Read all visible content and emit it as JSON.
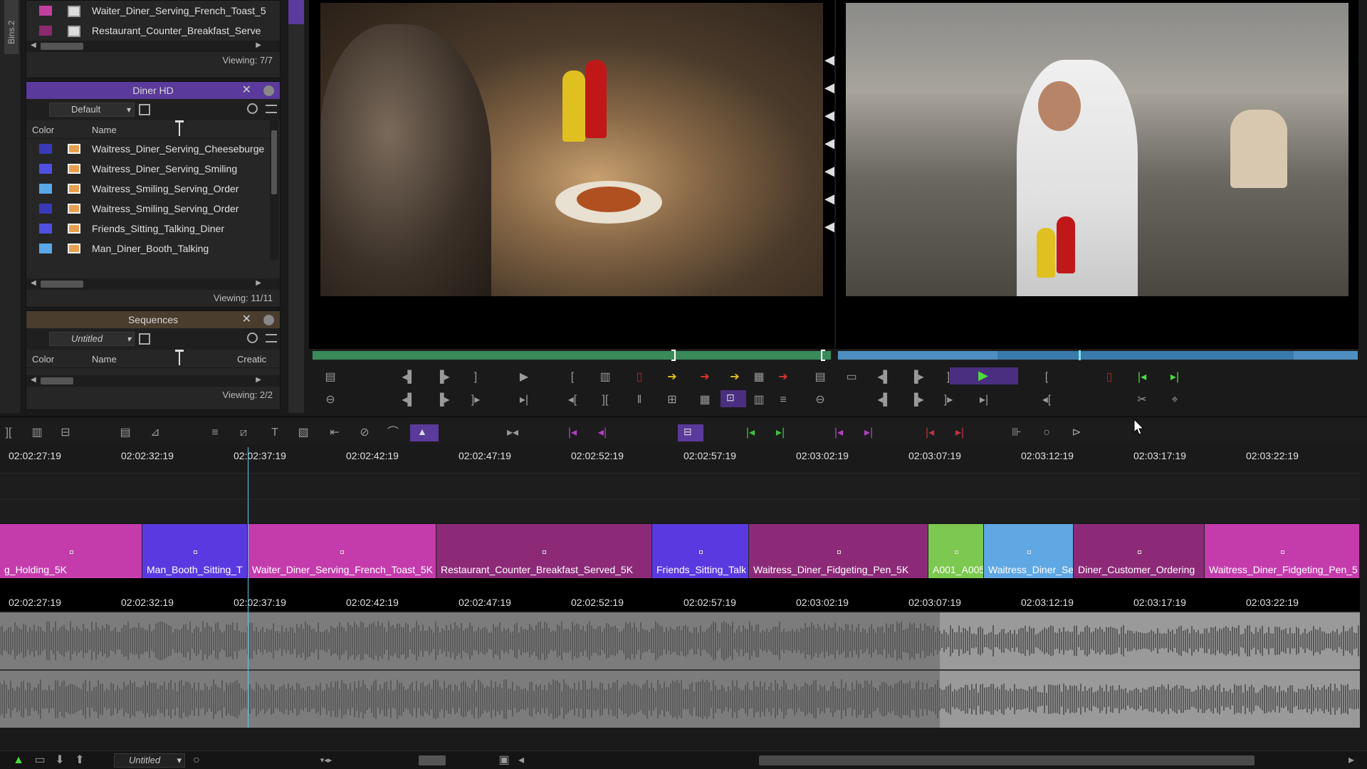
{
  "bins_tab_label": "Bins.2",
  "top_bin": {
    "items": [
      {
        "name": "Waiter_Diner_Serving_French_Toast_5",
        "color": "#c040a0"
      },
      {
        "name": "Restaurant_Counter_Breakfast_Serve",
        "color": "#8c2a70"
      }
    ],
    "viewing": "Viewing: 7/7"
  },
  "diner_bin": {
    "title": "Diner HD",
    "view": "Default",
    "col_color": "Color",
    "col_name": "Name",
    "items": [
      {
        "name": "Waitress_Diner_Serving_Cheeseburge",
        "color": "#3a3ab8"
      },
      {
        "name": "Waitress_Diner_Serving_Smiling",
        "color": "#5050e0"
      },
      {
        "name": "Waitress_Smiling_Serving_Order",
        "color": "#5aa8e8"
      },
      {
        "name": "Waitress_Smiling_Serving_Order",
        "color": "#3a3ab8"
      },
      {
        "name": "Friends_Sitting_Talking_Diner",
        "color": "#5050e0"
      },
      {
        "name": "Man_Diner_Booth_Talking",
        "color": "#5aa8e8"
      }
    ],
    "viewing": "Viewing: 11/11"
  },
  "sequences_bin": {
    "title": "Sequences",
    "view": "Untitled",
    "col_color": "Color",
    "col_name": "Name",
    "col_creation": "Creatic",
    "viewing": "Viewing: 2/2"
  },
  "ruler_timecodes": [
    "02:02:27:19",
    "02:02:32:19",
    "02:02:37:19",
    "02:02:42:19",
    "02:02:47:19",
    "02:02:52:19",
    "02:02:57:19",
    "02:03:02:19",
    "02:03:07:19",
    "02:03:12:19",
    "02:03:17:19",
    "02:03:22:19"
  ],
  "clips": [
    {
      "name": "g_Holding_5K",
      "color": "#c43cac"
    },
    {
      "name": "Man_Booth_Sitting_T",
      "color": "#5a3ae0"
    },
    {
      "name": "Waiter_Diner_Serving_French_Toast_5K",
      "color": "#c43cac"
    },
    {
      "name": "Restaurant_Counter_Breakfast_Served_5K",
      "color": "#8c2a78"
    },
    {
      "name": "Friends_Sitting_Talk",
      "color": "#5a3ae0"
    },
    {
      "name": "Waitress_Diner_Fidgeting_Pen_5K",
      "color": "#8c2a78"
    },
    {
      "name": "A001_A005",
      "color": "#7cc850"
    },
    {
      "name": "Waitress_Diner_Se",
      "color": "#60a8e4"
    },
    {
      "name": "Diner_Customer_Ordering",
      "color": "#8c2a78"
    },
    {
      "name": "Waitress_Diner_Fidgeting_Pen_5",
      "color": "#c43cac"
    }
  ],
  "status_bar": {
    "sequence_name": "Untitled"
  },
  "colors": {
    "accent_purple": "#5a3a9a",
    "play_green": "#4adc3c"
  }
}
